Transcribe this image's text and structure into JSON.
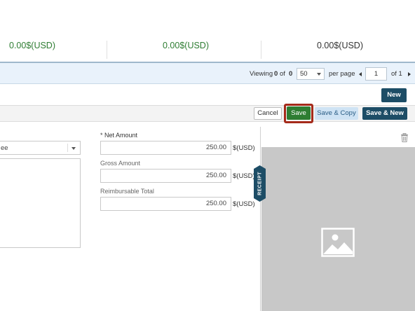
{
  "totals": {
    "net": "0.00$(USD)",
    "gross": "0.00$(USD)",
    "reimbursable": "0.00$(USD)"
  },
  "pager": {
    "viewing_label": "Viewing",
    "viewing_from": "0",
    "of_label": "of",
    "viewing_total": "0",
    "per_page_value": "50",
    "per_page_label": "per page",
    "current_page": "1",
    "of_pages_label": "of 1"
  },
  "buttons": {
    "new": "New",
    "cancel": "Cancel",
    "save": "Save",
    "save_copy": "Save & Copy",
    "save_new": "Save & New"
  },
  "form": {
    "dropdown_value": "ee",
    "net_amount_label": "Net Amount",
    "required_mark": "*",
    "net_amount_value": "250.00",
    "gross_amount_label": "Gross Amount",
    "gross_amount_value": "250.00",
    "reimbursable_total_label": "Reimbursable Total",
    "reimbursable_total_value": "250.00",
    "currency": "$(USD)"
  },
  "receipt": {
    "tab_label": "RECEIPT",
    "icons": [
      "trash-icon",
      "image-placeholder-icon"
    ]
  },
  "colors": {
    "accent_dark": "#1d4d66",
    "save_green": "#2e7d32",
    "highlight": "#a52a1a",
    "pager_bg": "#e9f2fb"
  }
}
